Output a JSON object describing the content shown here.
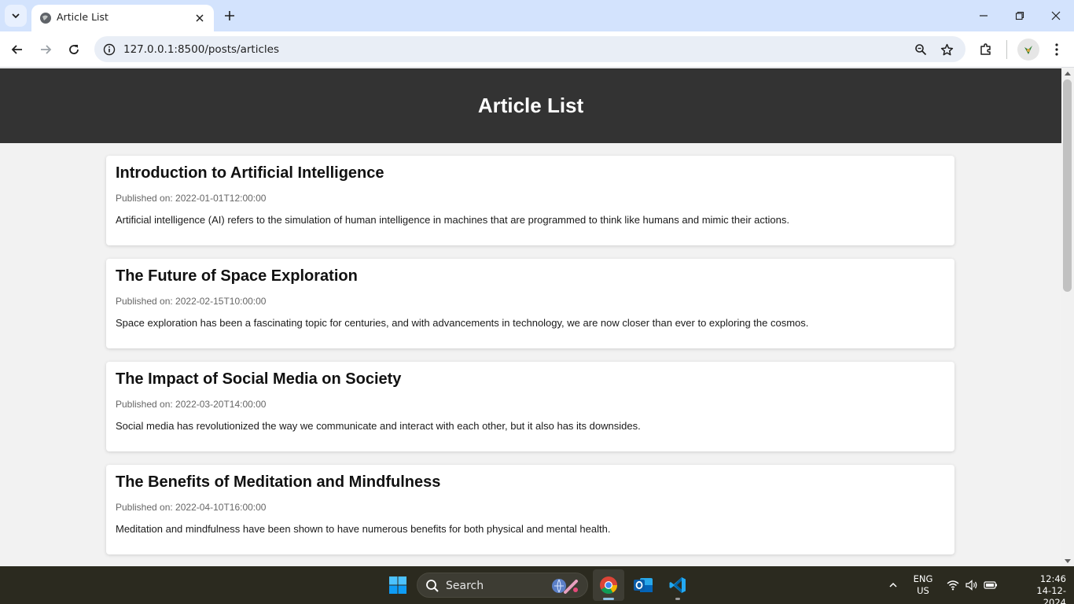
{
  "browser": {
    "tab_title": "Article List",
    "url": "127.0.0.1:8500/posts/articles"
  },
  "page": {
    "heading": "Article List",
    "articles": [
      {
        "title": "Introduction to Artificial Intelligence",
        "date": "Published on: 2022-01-01T12:00:00",
        "summary": "Artificial intelligence (AI) refers to the simulation of human intelligence in machines that are programmed to think like humans and mimic their actions."
      },
      {
        "title": "The Future of Space Exploration",
        "date": "Published on: 2022-02-15T10:00:00",
        "summary": "Space exploration has been a fascinating topic for centuries, and with advancements in technology, we are now closer than ever to exploring the cosmos."
      },
      {
        "title": "The Impact of Social Media on Society",
        "date": "Published on: 2022-03-20T14:00:00",
        "summary": "Social media has revolutionized the way we communicate and interact with each other, but it also has its downsides."
      },
      {
        "title": "The Benefits of Meditation and Mindfulness",
        "date": "Published on: 2022-04-10T16:00:00",
        "summary": "Meditation and mindfulness have been shown to have numerous benefits for both physical and mental health."
      }
    ]
  },
  "taskbar": {
    "search_label": "Search",
    "lang_line1": "ENG",
    "lang_line2": "US",
    "time": "12:46",
    "date": "14-12-2024"
  },
  "colors": {
    "header_bg": "#333333",
    "page_bg": "#f2f2f2",
    "tabstrip_bg": "#d3e3fd",
    "taskbar_bg": "#2b2a1f"
  }
}
